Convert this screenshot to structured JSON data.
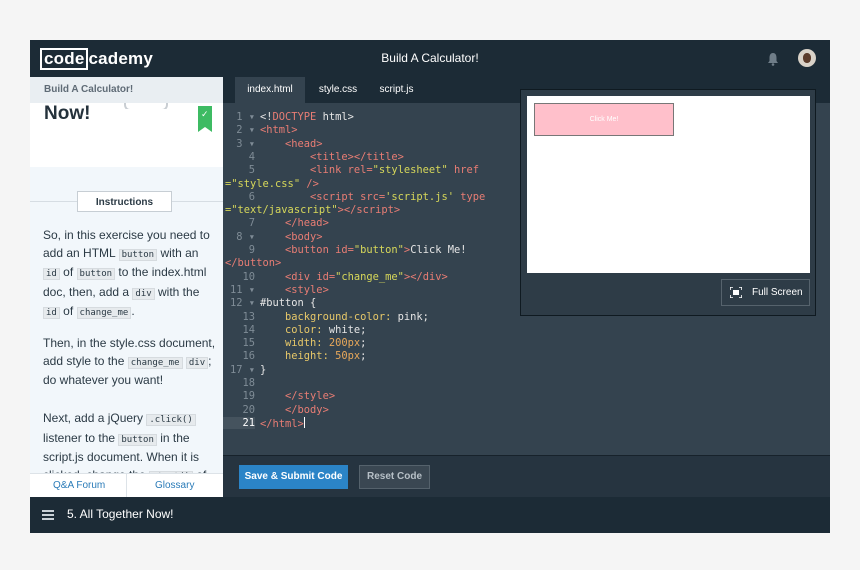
{
  "app": {
    "logo_left": "code",
    "logo_right": "cademy",
    "title": "Build A Calculator!",
    "bell_icon": "bell-icon",
    "avatar": "user-avatar"
  },
  "left": {
    "header": "Build A Calculator!",
    "lesson_title": "Now!",
    "instructions_label": "Instructions",
    "footer_left": "Q&A Forum",
    "footer_right": "Glossary"
  },
  "tabs": [
    "index.html",
    "style.css",
    "script.js"
  ],
  "preview": {
    "button_text": "Click Me!",
    "fullscreen_label": "Full Screen",
    "button_color": "#ffc0cb"
  },
  "actions": {
    "save": "Save & Submit Code",
    "reset": "Reset Code"
  },
  "bottom": {
    "lesson": "5. All Together Now!"
  },
  "colors": {
    "accent": "#2b84c7",
    "success": "#3dbb63",
    "background": "#263440"
  }
}
